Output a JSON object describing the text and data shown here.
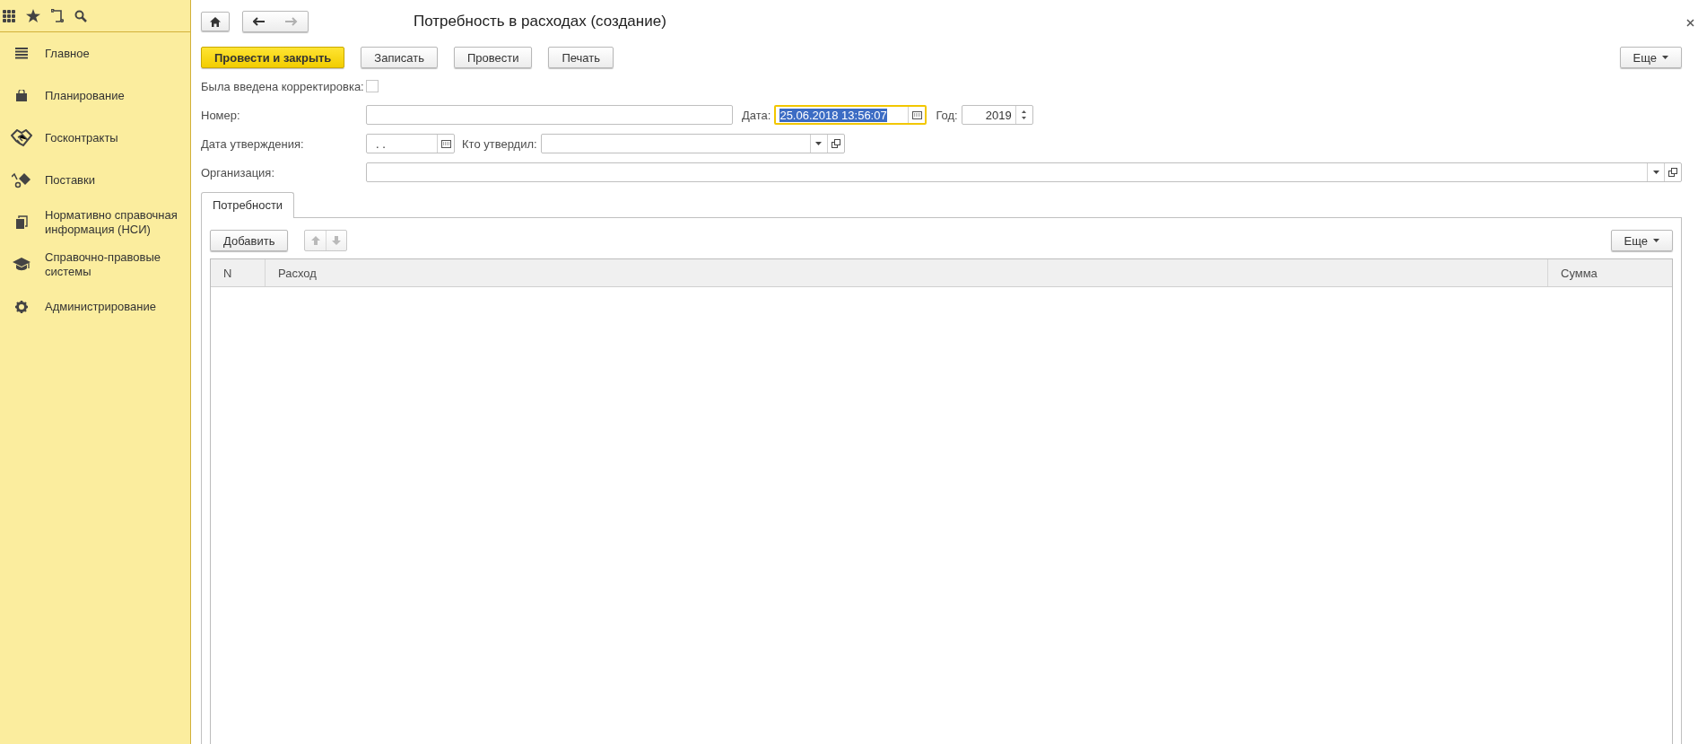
{
  "sidebar": {
    "items": [
      {
        "label": "Главное"
      },
      {
        "label": "Планирование"
      },
      {
        "label": "Госконтракты"
      },
      {
        "label": "Поставки"
      },
      {
        "label": "Нормативно справочная информация (НСИ)"
      },
      {
        "label": "Справочно-правовые системы"
      },
      {
        "label": "Администрирование"
      }
    ]
  },
  "header": {
    "title": "Потребность в расходах (создание)",
    "back": {
      "disabled": false
    },
    "forward": {
      "disabled": true
    }
  },
  "toolbar": {
    "buttons": [
      {
        "label": "Провести и закрыть",
        "primary": true
      },
      {
        "label": "Записать",
        "primary": false
      },
      {
        "label": "Провести",
        "primary": false
      },
      {
        "label": "Печать",
        "primary": false
      }
    ],
    "more": "Еще"
  },
  "form": {
    "correction": {
      "label": "Была введена корректировка:",
      "checked": false
    },
    "number": {
      "label": "Номер:"
    },
    "date": {
      "label": "Дата:",
      "value": "25.06.2018 13:56:07",
      "focused": true
    },
    "year": {
      "label": "Год:",
      "value": "2019"
    },
    "approval_date": {
      "label": "Дата утверждения:",
      "value": ".  ."
    },
    "approver": {
      "label": "Кто утвердил:"
    },
    "organization": {
      "label": "Организация:"
    }
  },
  "tabs": [
    {
      "label": "Потребности",
      "selected": true
    }
  ],
  "table_toolbar": {
    "add": "Добавить",
    "move_up": {
      "disabled": true
    },
    "move_down": {
      "disabled": true
    },
    "more": "Еще"
  },
  "table": {
    "columns": [
      "N",
      "Расход",
      "Сумма"
    ]
  }
}
